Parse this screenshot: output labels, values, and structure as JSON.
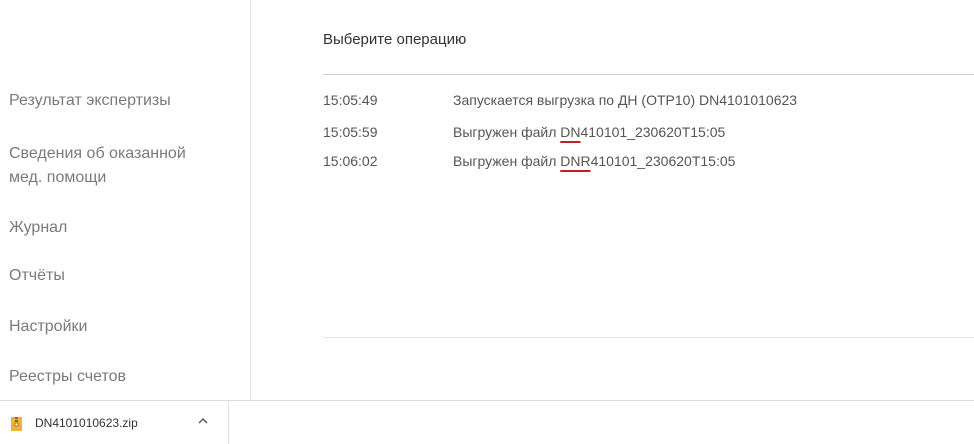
{
  "sidebar": {
    "items": [
      {
        "label": "Результат экспертизы"
      },
      {
        "label_line1": "Сведения об оказанной",
        "label_line2": "мед. помощи"
      },
      {
        "label": "Журнал"
      },
      {
        "label": "Отчёты"
      },
      {
        "label": "Настройки"
      },
      {
        "label": "Реестры счетов"
      }
    ]
  },
  "main": {
    "title": "Выберите операцию",
    "log": [
      {
        "time": "15:05:49",
        "message": "Запускается выгрузка по ДН (ОТР10) DN4101010623"
      },
      {
        "time": "15:05:59",
        "prefix": "Выгружен файл ",
        "marked": "DN",
        "rest": "410101_230620T15:05"
      },
      {
        "time": "15:06:02",
        "prefix": "Выгружен файл ",
        "marked": "DNR",
        "rest": "410101_230620T15:05"
      }
    ]
  },
  "downloads": {
    "file_name": "DN4101010623.zip",
    "icon": "zip-archive-icon",
    "chevron_icon": "chevron-up-icon"
  },
  "colors": {
    "spellcheck_underline": "#c0202a",
    "zip_icon": "#e8b53a"
  }
}
